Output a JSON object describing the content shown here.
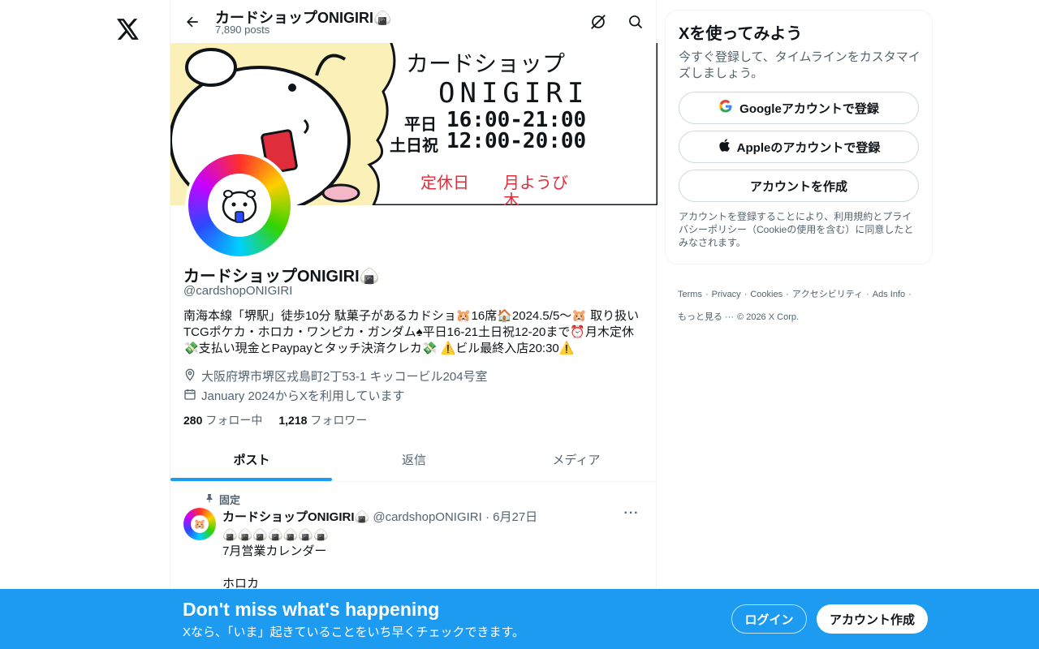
{
  "header": {
    "title": "カードショップONIGIRI🍙",
    "posts": "7,890 posts"
  },
  "banner": {
    "line1": "カードショップ",
    "line2": "ONIGIRI",
    "weekday_label": "平日",
    "weekday_hours": "16:00-21:00",
    "weekend_label": "土日祝",
    "weekend_hours": "12:00-20:00",
    "closed_label": "定休日",
    "closed_days": "月ようび",
    "closed_days2": "木",
    "avatar_ring": "カードショップONIGIRI"
  },
  "profile": {
    "name": "カードショップONIGIRI🍙",
    "handle": "@cardshopONIGIRI",
    "bio": "南海本線「堺駅」徒歩10分 駄菓子があるカドショ🐹16席🏠2024.5/5〜🐹 取り扱いTCGポケカ・ホロカ・ワンピカ・ガンダム♠平日16-21土日祝12-20まで⏰月木定休💸支払い現金とPaypayとタッチ決済クレカ💸 ⚠️ビル最終入店20:30⚠️",
    "location": "大阪府堺市堺区戎島町2丁53-1 キッコービル204号室",
    "joined": "January 2024からXを利用しています",
    "following_count": "280",
    "following_label": "フォロー中",
    "followers_count": "1,218",
    "followers_label": "フォロワー"
  },
  "tabs": [
    {
      "label": "ポスト",
      "active": true
    },
    {
      "label": "返信",
      "active": false
    },
    {
      "label": "メディア",
      "active": false
    }
  ],
  "pinned_post": {
    "pinned_label": "固定",
    "name": "カードショップONIGIRI🍙",
    "handle": "@cardshopONIGIRI",
    "date": "· 6月27日",
    "more": "···",
    "text": "🍙🍙🍙🍙🍙🍙🍙\n7月営業カレンダー\n\nホロカ"
  },
  "sidebar": {
    "title": "Xを使ってみよう",
    "lead": "今すぐ登録して、タイムラインをカスタマイズしましょう。",
    "google_button": "Googleアカウントで登録",
    "apple_button": "Appleのアカウントで登録",
    "create_button": "アカウントを作成",
    "terms": "アカウントを登録することにより、利用規約とプライバシーポリシー（Cookieの使用を含む）に同意したとみなされます。"
  },
  "footer": {
    "links": [
      "Terms",
      "·",
      "Privacy",
      "·",
      "Cookies",
      "·",
      "アクセシビリティ",
      "·",
      "Ads Info",
      "·"
    ],
    "more": "もっと見る ···",
    "copyright": "© 2026 X Corp."
  },
  "bottom_bar": {
    "title": "Don't miss what's happening",
    "subtitle": "Xなら、「いま」起きていることをいち早くチェックできます。",
    "login": "ログイン",
    "signup": "アカウント作成"
  },
  "colors": {
    "accent": "#1d9bf0",
    "banner_bg": "#fbf1b8",
    "text": "#0f1419",
    "muted": "#536471"
  }
}
